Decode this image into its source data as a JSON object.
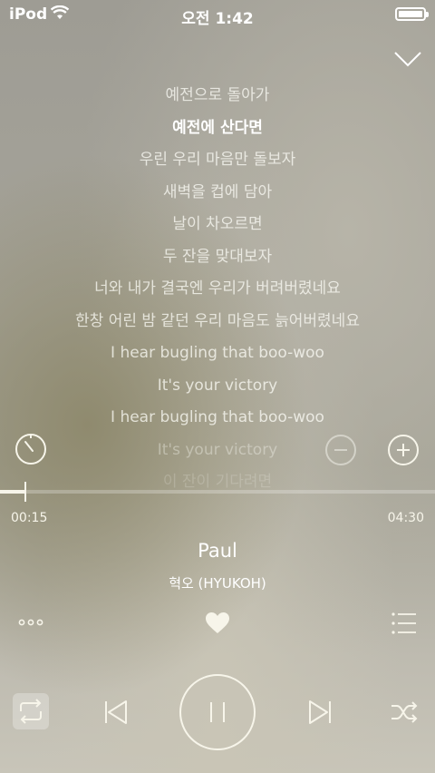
{
  "status_bar": {
    "carrier": "iPod",
    "time": "오전 1:42"
  },
  "lyrics": [
    "예전으로 돌아가",
    "예전에 산다면",
    "우린 우리 마음만 돌보자",
    "새벽을 컵에 담아",
    "날이 차오르면",
    "두 잔을 맞대보자",
    "너와 내가 결국엔 우리가 버려버렸네요",
    "한창 어린 밤 같던 우리 마음도 늙어버렸네요",
    "I hear bugling that boo-woo",
    "It's your victory",
    "I hear bugling that boo-woo",
    "It's your victory",
    "이 잔이 기다려면"
  ],
  "current_lyric_index": 1,
  "playback": {
    "current_time": "00:15",
    "total_time": "04:30",
    "progress": 0.058
  },
  "track": {
    "title": "Paul",
    "artist": "혁오 (HYUKOH)"
  },
  "controls": {
    "repeat_icon": "repeat-icon",
    "prev_icon": "previous-icon",
    "pause_icon": "pause-icon",
    "next_icon": "next-icon",
    "shuffle_icon": "shuffle-icon",
    "timer_icon": "timer-icon",
    "minus_icon": "minus-icon",
    "plus_icon": "plus-icon",
    "more_icon": "more-icon",
    "like_icon": "heart-icon",
    "playlist_icon": "playlist-icon",
    "collapse_icon": "chevron-down-icon"
  },
  "colors": {
    "foreground": "#f7f5ea",
    "accent": "#ffffff"
  }
}
